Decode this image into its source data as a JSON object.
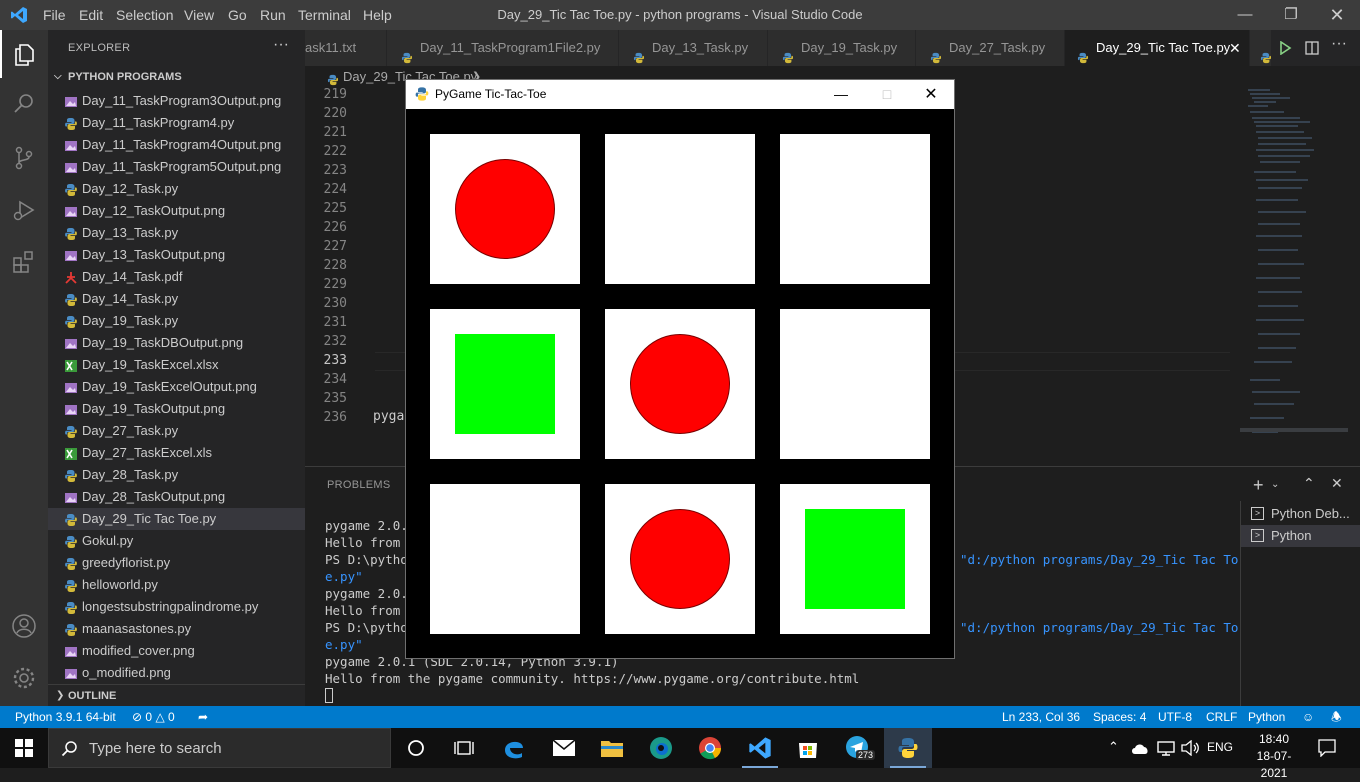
{
  "titlebar": {
    "title": "Day_29_Tic Tac Toe.py - python programs - Visual Studio Code",
    "menu": [
      "File",
      "Edit",
      "Selection",
      "View",
      "Go",
      "Run",
      "Terminal",
      "Help"
    ]
  },
  "sidebar": {
    "title": "EXPLORER",
    "folder": "PYTHON PROGRAMS",
    "outline": "OUTLINE",
    "files": [
      {
        "name": "Day_11_TaskProgram3Output.png",
        "icon": "image-file-icon"
      },
      {
        "name": "Day_11_TaskProgram4.py",
        "icon": "python-file-icon"
      },
      {
        "name": "Day_11_TaskProgram4Output.png",
        "icon": "image-file-icon"
      },
      {
        "name": "Day_11_TaskProgram5Output.png",
        "icon": "image-file-icon"
      },
      {
        "name": "Day_12_Task.py",
        "icon": "python-file-icon"
      },
      {
        "name": "Day_12_TaskOutput.png",
        "icon": "image-file-icon"
      },
      {
        "name": "Day_13_Task.py",
        "icon": "python-file-icon"
      },
      {
        "name": "Day_13_TaskOutput.png",
        "icon": "image-file-icon"
      },
      {
        "name": "Day_14_Task.pdf",
        "icon": "pdf-file-icon"
      },
      {
        "name": "Day_14_Task.py",
        "icon": "python-file-icon"
      },
      {
        "name": "Day_19_Task.py",
        "icon": "python-file-icon"
      },
      {
        "name": "Day_19_TaskDBOutput.png",
        "icon": "image-file-icon"
      },
      {
        "name": "Day_19_TaskExcel.xlsx",
        "icon": "excel-file-icon"
      },
      {
        "name": "Day_19_TaskExcelOutput.png",
        "icon": "image-file-icon"
      },
      {
        "name": "Day_19_TaskOutput.png",
        "icon": "image-file-icon"
      },
      {
        "name": "Day_27_Task.py",
        "icon": "python-file-icon"
      },
      {
        "name": "Day_27_TaskExcel.xls",
        "icon": "excel-file-icon"
      },
      {
        "name": "Day_28_Task.py",
        "icon": "python-file-icon"
      },
      {
        "name": "Day_28_TaskOutput.png",
        "icon": "image-file-icon"
      },
      {
        "name": "Day_29_Tic Tac Toe.py",
        "icon": "python-file-icon",
        "selected": true
      },
      {
        "name": "Gokul.py",
        "icon": "python-file-icon"
      },
      {
        "name": "greedyflorist.py",
        "icon": "python-file-icon"
      },
      {
        "name": "helloworld.py",
        "icon": "python-file-icon"
      },
      {
        "name": "longestsubstringpalindrome.py",
        "icon": "python-file-icon"
      },
      {
        "name": "maanasastones.py",
        "icon": "python-file-icon"
      },
      {
        "name": "modified_cover.png",
        "icon": "image-file-icon"
      },
      {
        "name": "o_modified.png",
        "icon": "image-file-icon"
      }
    ]
  },
  "tabs": [
    {
      "label": "ask11.txt"
    },
    {
      "label": "Day_11_TaskProgram1File2.py"
    },
    {
      "label": "Day_13_Task.py"
    },
    {
      "label": "Day_19_Task.py"
    },
    {
      "label": "Day_27_Task.py"
    },
    {
      "label": "Day_29_Tic Tac Toe.py",
      "active": true
    }
  ],
  "editor": {
    "breadcrumb": "Day_29_Tic Tac Toe.py",
    "line_numbers": [
      "219",
      "220",
      "221",
      "222",
      "223",
      "224",
      "225",
      "226",
      "227",
      "228",
      "229",
      "230",
      "231",
      "232",
      "233",
      "234",
      "235",
      "236"
    ],
    "current_line": "233",
    "code_line_236": "pyga"
  },
  "panel": {
    "problems_tab": "PROBLEMS",
    "terminal_lines": [
      "pygame 2.0.1",
      "Hello from t",
      "PS D:\\python",
      "e.py\"",
      "pygame 2.0.1",
      "Hello from t",
      "PS D:\\python",
      "e.py\"",
      "pygame 2.0.1 (SDL 2.0.14, Python 3.9.1)",
      "Hello from the pygame community. https://www.pygame.org/contribute.html"
    ],
    "run_path": "\"d:/python programs/Day_29_Tic Tac To",
    "terminals": [
      "Python Deb...",
      "Python"
    ]
  },
  "statusbar": {
    "interpreter": "Python 3.9.1 64-bit",
    "errors": "0",
    "warnings": "0",
    "position": "Ln 233, Col 36",
    "spaces": "Spaces: 4",
    "encoding": "UTF-8",
    "eol": "CRLF",
    "language": "Python"
  },
  "taskbar": {
    "search_placeholder": "Type here to search",
    "time": "18:40",
    "date": "18-07-2021",
    "language": "ENG",
    "telegram_badge": "273"
  },
  "pygame": {
    "title": "PyGame Tic-Tac-Toe",
    "board": [
      "circle",
      "empty",
      "empty",
      "square",
      "circle",
      "empty",
      "empty",
      "circle",
      "square"
    ],
    "colors": {
      "circle": "#ff0000",
      "square": "#00ff00",
      "cell": "#ffffff",
      "background": "#000000"
    }
  },
  "colors": {
    "accent": "#007acc"
  }
}
